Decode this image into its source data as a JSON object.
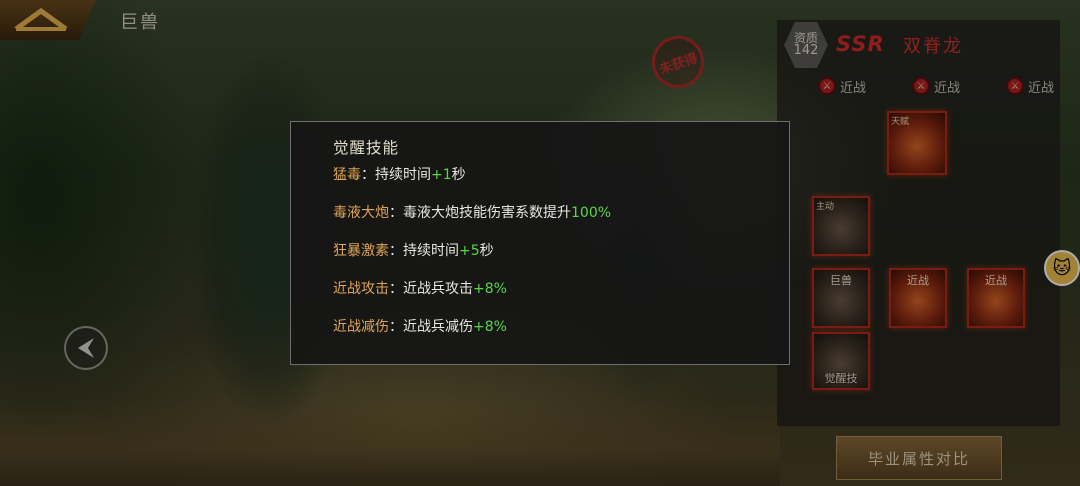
{
  "header": {
    "breadcrumb": "巨兽"
  },
  "stamp": {
    "text": "未获得",
    "color": "#c23030"
  },
  "dino": {
    "quality_label": "资质",
    "quality_value": "142",
    "rarity": "SSR",
    "name": "双脊龙",
    "tags": [
      {
        "icon": "melee-icon",
        "label": "近战"
      },
      {
        "icon": "melee-icon",
        "label": "近战"
      },
      {
        "icon": "melee-icon",
        "label": "近战"
      }
    ]
  },
  "skills": {
    "top_label": "天赋",
    "active_label": "主动",
    "giant_label": "巨兽",
    "melee1_label": "近战",
    "melee2_label": "近战",
    "awaken_label": "觉醒技"
  },
  "compare_button": "毕业属性对比",
  "popup": {
    "title": "觉醒技能",
    "rows": [
      {
        "name": "猛毒",
        "sep": "：",
        "text": "持续时间",
        "plus": "+1",
        "suffix": "秒"
      },
      {
        "name": "毒液大炮",
        "sep": "：",
        "text": "毒液大炮技能伤害系数提升",
        "plus": "100%",
        "suffix": ""
      },
      {
        "name": "狂暴激素",
        "sep": "：",
        "text": "持续时间",
        "plus": "+5",
        "suffix": "秒"
      },
      {
        "name": "近战攻击",
        "sep": "：",
        "text": "近战兵攻击",
        "plus": "+8%",
        "suffix": ""
      },
      {
        "name": "近战减伤",
        "sep": "：",
        "text": "近战兵减伤",
        "plus": "+8%",
        "suffix": ""
      }
    ]
  },
  "colors": {
    "skill_name": "#e0a558",
    "bonus_value": "#58d64a",
    "rarity_red": "#d42a2a"
  }
}
